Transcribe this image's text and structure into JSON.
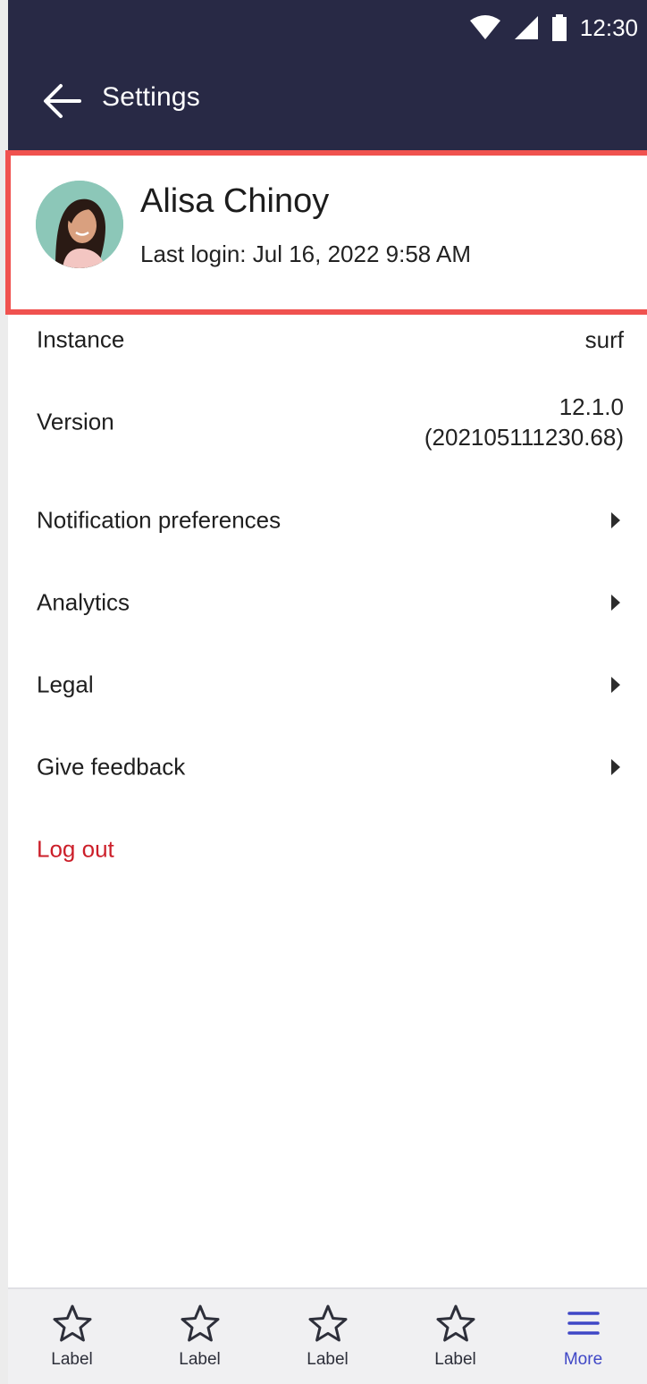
{
  "status_bar": {
    "time": "12:30"
  },
  "app_bar": {
    "title": "Settings"
  },
  "profile": {
    "name": "Alisa Chinoy",
    "last_login": "Last login: Jul 16, 2022 9:58 AM"
  },
  "settings": {
    "instance": {
      "label": "Instance",
      "value": "surf"
    },
    "version": {
      "label": "Version",
      "value_line1": "12.1.0",
      "value_line2": "(202105111230.68)"
    },
    "items": [
      {
        "label": "Notification preferences"
      },
      {
        "label": "Analytics"
      },
      {
        "label": "Legal"
      },
      {
        "label": "Give feedback"
      }
    ],
    "logout": {
      "label": "Log out",
      "color": "#cc1f2a"
    }
  },
  "bottom_nav": {
    "items": [
      {
        "label": "Label",
        "icon": "star-icon"
      },
      {
        "label": "Label",
        "icon": "star-icon"
      },
      {
        "label": "Label",
        "icon": "star-icon"
      },
      {
        "label": "Label",
        "icon": "star-icon"
      },
      {
        "label": "More",
        "icon": "menu-icon",
        "active": true
      }
    ]
  },
  "colors": {
    "header": "#282945",
    "highlight_border": "#f0524f",
    "active_nav": "#3f47c6",
    "logout": "#cc1f2a"
  }
}
